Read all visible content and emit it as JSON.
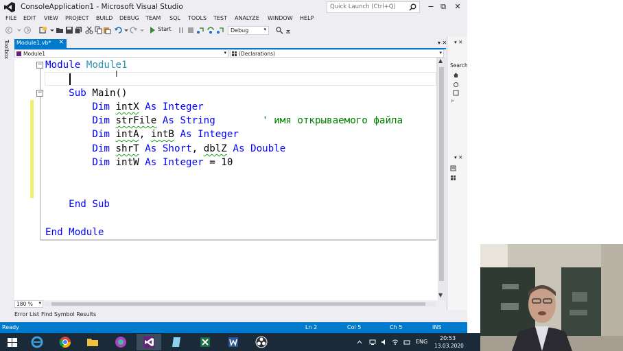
{
  "window": {
    "title": "ConsoleApplication1 - Microsoft Visual Studio",
    "quick_launch_placeholder": "Quick Launch (Ctrl+Q)",
    "controls": {
      "minimize": "−",
      "restore": "⧉",
      "close": "✕"
    }
  },
  "menu": [
    "FILE",
    "EDIT",
    "VIEW",
    "PROJECT",
    "BUILD",
    "DEBUG",
    "TEAM",
    "SQL",
    "TOOLS",
    "TEST",
    "ANALYZE",
    "WINDOW",
    "HELP"
  ],
  "toolbar": {
    "start_label": "Start",
    "configuration": "Debug"
  },
  "toolbox_label": "Toolbox",
  "document_tab": {
    "label": "Module1.vb*",
    "close": "✕"
  },
  "tab_controls": "▾  ✕",
  "navbar": {
    "left": "Module1",
    "right": "(Declarations)"
  },
  "code": {
    "line1_kw": "Module",
    "line1_name": "Module1",
    "line3_kw": "Sub",
    "line3_rest": " Main()",
    "dim1": {
      "dim": "Dim",
      "var": "intX",
      "as": "As",
      "type": "Integer"
    },
    "dim2": {
      "dim": "Dim",
      "var": "strFile",
      "as": "As",
      "type": "String",
      "comment": "' имя открываемого файла"
    },
    "dim3": {
      "dim": "Dim",
      "var1": "intA",
      "sep": ", ",
      "var2": "intB",
      "as": "As",
      "type": "Integer"
    },
    "dim4": {
      "dim": "Dim",
      "var1": "shrT",
      "as1": "As",
      "type1": "Short",
      "sep": ", ",
      "var2": "dblZ",
      "as2": "As",
      "type2": "Double"
    },
    "dim5": {
      "dim": "Dim",
      "var": "intW",
      "as": "As",
      "type": "Integer",
      "rest": " = 10"
    },
    "end_sub": "End Sub",
    "end_module": "End Module"
  },
  "zoom": "180 %",
  "bottom_tabs": [
    "Error List",
    "Find Symbol Results"
  ],
  "status": {
    "ready": "Ready",
    "ln": "Ln 2",
    "col": "Col 5",
    "ch": "Ch 5",
    "ins": "INS"
  },
  "right_pane": {
    "search": "Search"
  },
  "taskbar": {
    "lang": "ENG",
    "time": "20:53",
    "date": "13.03.2020"
  },
  "colors": {
    "accent": "#007acc",
    "keyword": "#0000ff",
    "type": "#2b91af",
    "comment": "#008000"
  }
}
